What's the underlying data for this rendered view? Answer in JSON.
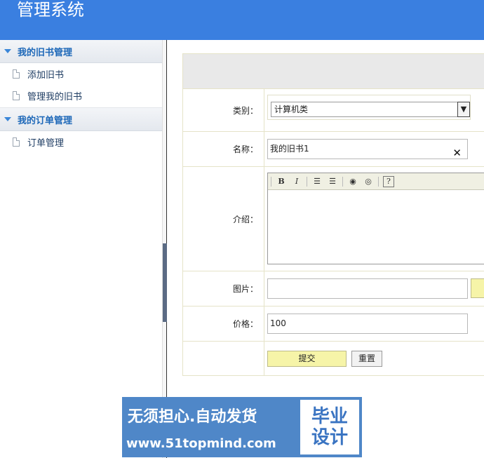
{
  "header": {
    "title": "管理系统"
  },
  "sidebar": {
    "groups": [
      {
        "title": "我的旧书管理",
        "items": [
          {
            "label": "添加旧书"
          },
          {
            "label": "管理我的旧书"
          }
        ]
      },
      {
        "title": "我的订单管理",
        "items": [
          {
            "label": "订单管理"
          }
        ]
      }
    ]
  },
  "form": {
    "category_label": "类别：",
    "category_value": "计算机类",
    "name_label": "名称：",
    "name_value": "我的旧书1",
    "intro_label": "介绍：",
    "image_label": "图片：",
    "image_value": "",
    "price_label": "价格：",
    "price_value": "100",
    "submit_label": "提交",
    "reset_label": "重置"
  },
  "editor_toolbar": {
    "bold": "B",
    "italic": "I",
    "help": "?"
  },
  "watermark": {
    "line1": "无须担心.自动发货",
    "line2": "www.51topmind.com",
    "badge_line1": "毕业",
    "badge_line2": "设计"
  }
}
